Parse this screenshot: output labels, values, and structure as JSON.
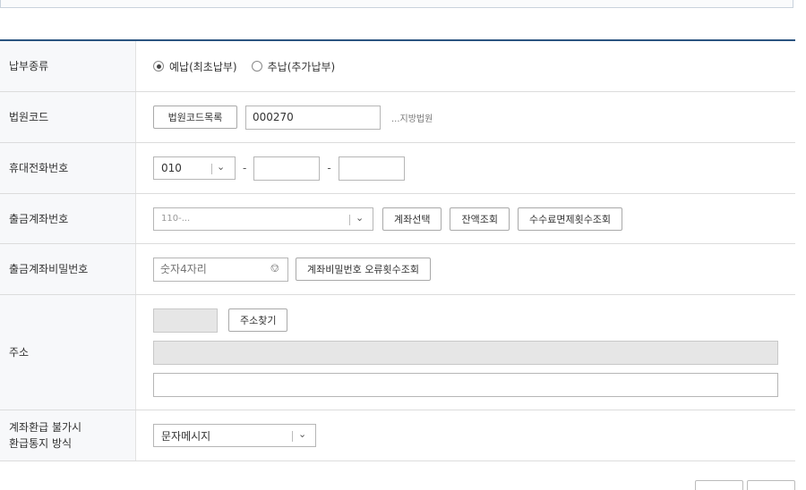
{
  "form": {
    "payment_type": {
      "label": "납부종류",
      "options": [
        {
          "label": "예납(최초납부)",
          "selected": true
        },
        {
          "label": "추납(추가납부)",
          "selected": false
        }
      ]
    },
    "court_code": {
      "label": "법원코드",
      "list_button": "법원코드목록",
      "value": "000270",
      "court_name": "...지방법원"
    },
    "mobile": {
      "label": "휴대전화번호",
      "prefix": "010",
      "middle": "",
      "last": "",
      "separator": "-"
    },
    "account": {
      "label": "출금계좌번호",
      "value": "110-...",
      "btn_select": "계좌선택",
      "btn_balance": "잔액조회",
      "btn_fee": "수수료면제횟수조회"
    },
    "account_password": {
      "label": "출금계좌비밀번호",
      "placeholder": "숫자4자리",
      "btn_error_count": "계좌비밀번호 오류횟수조회"
    },
    "address": {
      "label": "주소",
      "postcode": "",
      "btn_search": "주소찾기",
      "line1": "",
      "line2": ""
    },
    "refund_notice": {
      "label_line1": "계좌환급 불가시",
      "label_line2": "환급통지 방식",
      "value": "문자메시지"
    }
  },
  "colors": {
    "header_line": "#2a5480",
    "label_bg": "#f7f8fa",
    "readonly_bg": "#e6e6e6"
  }
}
